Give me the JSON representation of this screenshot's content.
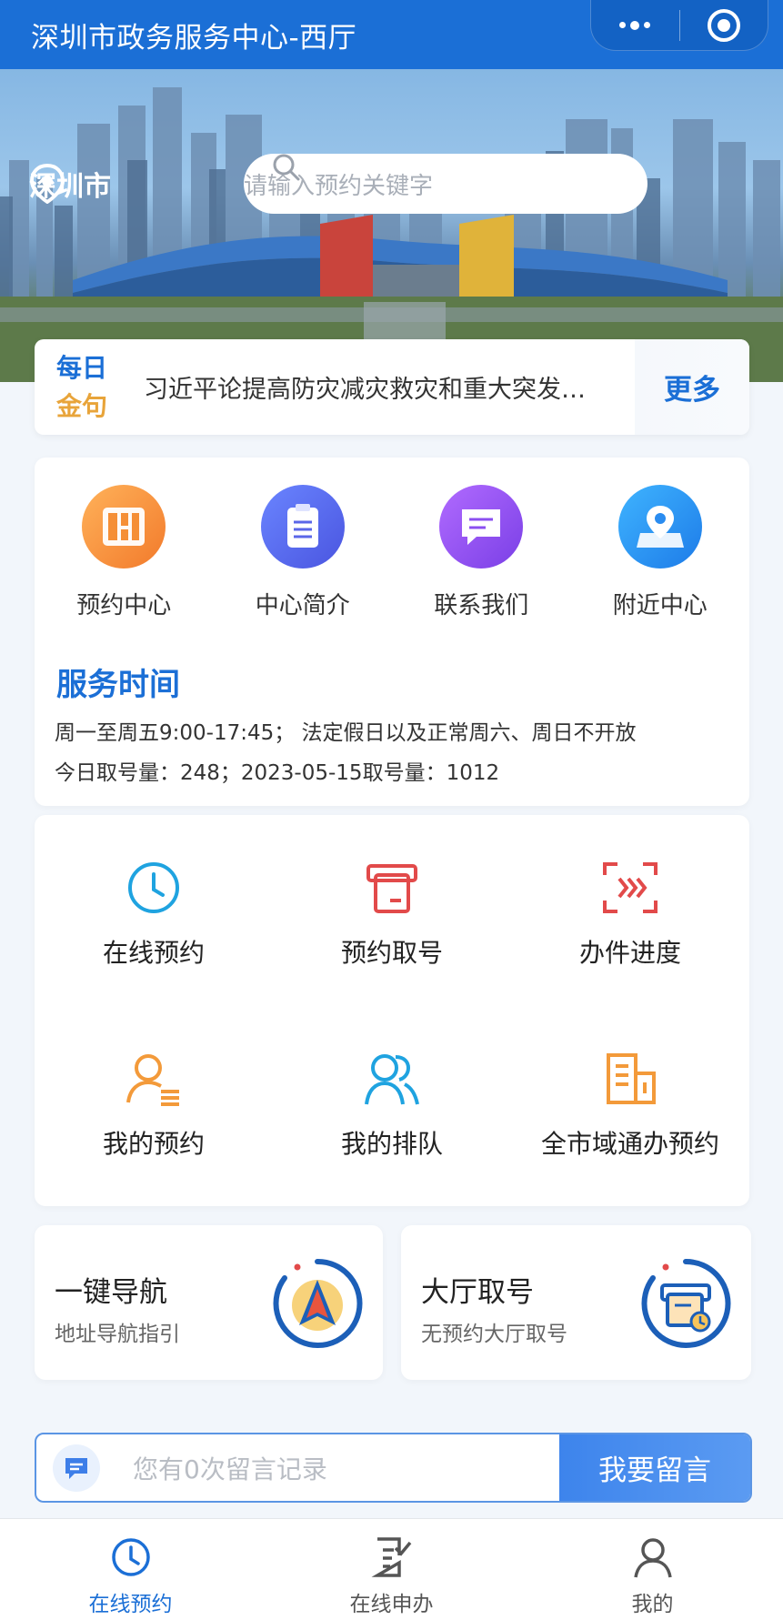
{
  "header": {
    "title": "深圳市政务服务中心-西厅"
  },
  "banner": {
    "city": "深圳市",
    "search_placeholder": "请输入预约关键字"
  },
  "quote": {
    "tag_line1": "每日",
    "tag_line2": "金句",
    "text": "习近平论提高防灾减灾救灾和重大突发…",
    "more": "更多"
  },
  "quick": {
    "items": [
      {
        "label": "预约中心",
        "icon": "grid-icon"
      },
      {
        "label": "中心简介",
        "icon": "clipboard-icon"
      },
      {
        "label": "联系我们",
        "icon": "chat-icon"
      },
      {
        "label": "附近中心",
        "icon": "map-pin-icon"
      }
    ],
    "service_title": "服务时间",
    "service_hours": "周一至周五9:00-17:45； 法定假日以及正常周六、周日不开放",
    "ticket_stats": "今日取号量：248；2023-05-15取号量：1012"
  },
  "grid": {
    "items": [
      {
        "label": "在线预约",
        "icon": "clock-icon"
      },
      {
        "label": "预约取号",
        "icon": "ticket-machine-icon"
      },
      {
        "label": "办件进度",
        "icon": "scan-progress-icon"
      },
      {
        "label": "我的预约",
        "icon": "user-list-icon"
      },
      {
        "label": "我的排队",
        "icon": "users-icon"
      },
      {
        "label": "全市域通办预约",
        "icon": "building-icon"
      }
    ]
  },
  "cards": {
    "nav_title": "一键导航",
    "nav_sub": "地址导航指引",
    "hall_title": "大厅取号",
    "hall_sub": "无预约大厅取号"
  },
  "message": {
    "placeholder": "您有0次留言记录",
    "button": "我要留言"
  },
  "tabbar": {
    "items": [
      {
        "label": "在线预约",
        "active": true
      },
      {
        "label": "在线申办",
        "active": false
      },
      {
        "label": "我的",
        "active": false
      }
    ]
  },
  "colors": {
    "primary": "#1b6fd6",
    "accent_gold": "#e8a43a",
    "orange": "#f39a3a",
    "purple": "#8a5cf0",
    "red": "#e24a4a"
  }
}
